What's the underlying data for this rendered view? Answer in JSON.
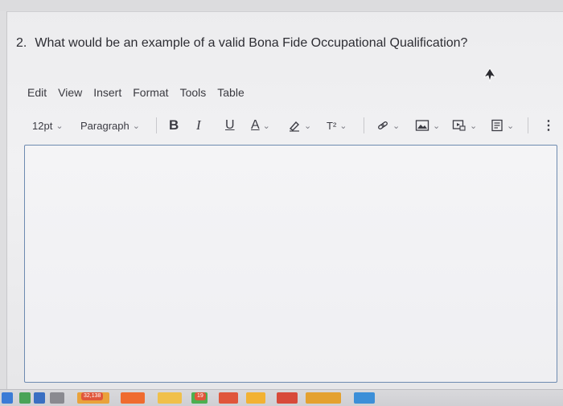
{
  "question": {
    "number": "2.",
    "text": "What would be an example of a valid Bona Fide Occupational Qualification?"
  },
  "menubar": {
    "items": [
      "Edit",
      "View",
      "Insert",
      "Format",
      "Tools",
      "Table"
    ]
  },
  "toolbar": {
    "font_size": "12pt",
    "paragraph": "Paragraph",
    "bold": "B",
    "italic": "I",
    "underline": "U",
    "text_color": "A",
    "superscript": "T²",
    "more": "⋮"
  },
  "editor": {
    "value": ""
  },
  "taskbar": {
    "badge_1": "32,138",
    "badge_2": "19"
  },
  "colors": {
    "editor_border": "#6d8ab0",
    "text": "#2d2d33"
  }
}
